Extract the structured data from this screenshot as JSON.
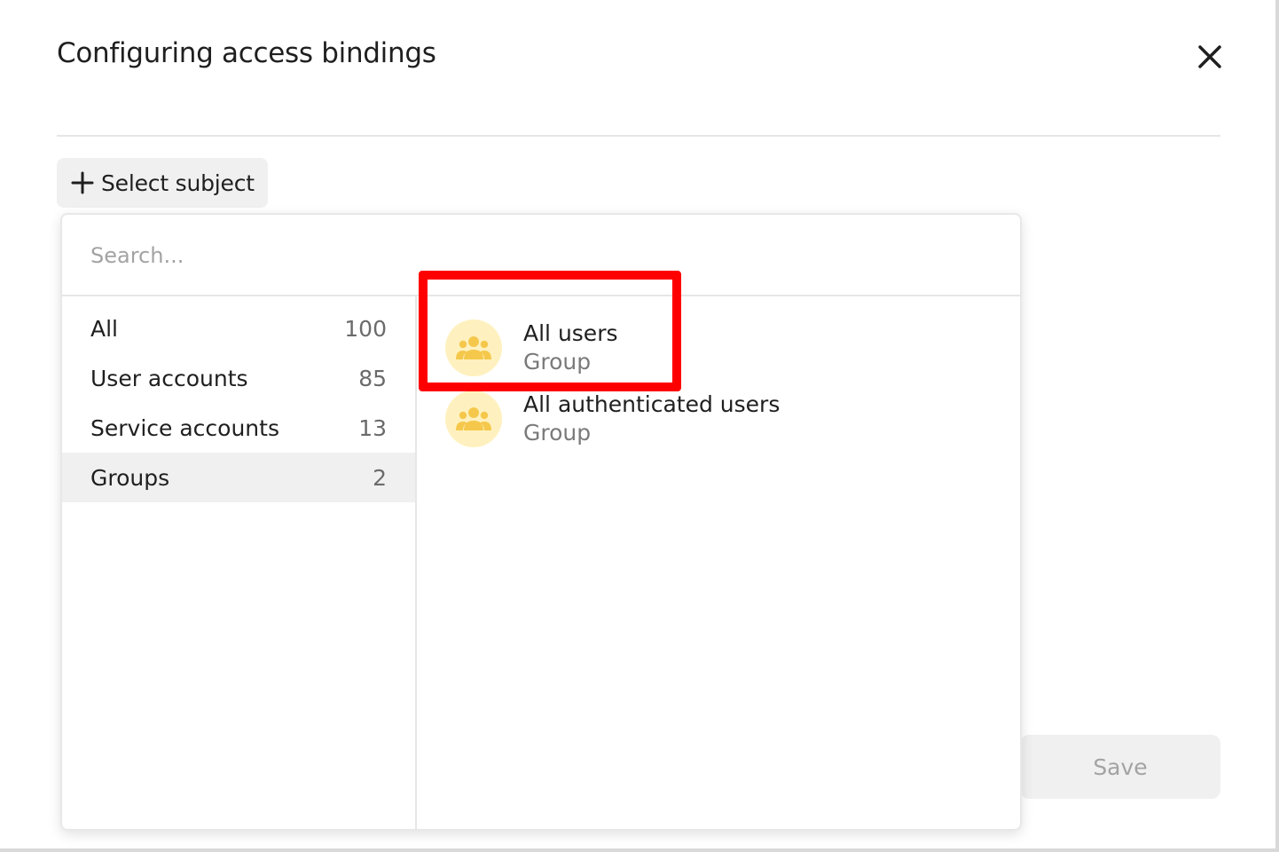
{
  "dialog": {
    "title": "Configuring access bindings",
    "close_icon": "close-icon",
    "select_subject_label": "Select subject",
    "save_label": "Save"
  },
  "popup": {
    "search_placeholder": "Search...",
    "categories": [
      {
        "label": "All",
        "count": "100"
      },
      {
        "label": "User accounts",
        "count": "85"
      },
      {
        "label": "Service accounts",
        "count": "13"
      },
      {
        "label": "Groups",
        "count": "2",
        "selected": true
      }
    ],
    "results": [
      {
        "name": "All users",
        "type": "Group",
        "icon": "group-icon"
      },
      {
        "name": "All authenticated users",
        "type": "Group",
        "icon": "group-icon"
      }
    ]
  },
  "colors": {
    "highlight": "#ff0000",
    "group_avatar_bg": "#fff1bf",
    "group_icon": "#f5c84c"
  }
}
